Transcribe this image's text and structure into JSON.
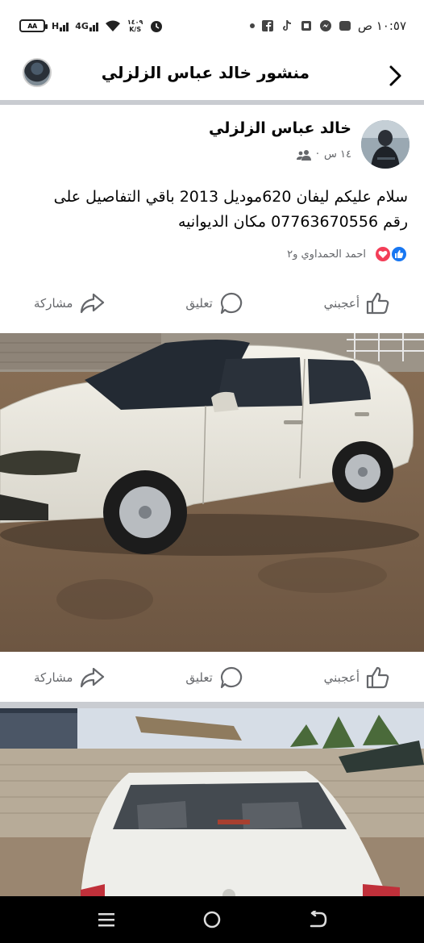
{
  "status_bar": {
    "time": "١٠:٥٧ ص",
    "battery": "AA",
    "network": "4G",
    "speed_value": "١٤٠٩",
    "speed_unit": "K/S",
    "notification_icons": [
      "dot-icon",
      "facebook-icon",
      "tiktok-icon",
      "sim-icon",
      "messenger-icon",
      "gallery-icon"
    ]
  },
  "header": {
    "title": "منشور خالد عباس الزلزلي",
    "back_icon": "chevron-right-icon"
  },
  "post": {
    "author": "خالد عباس الزلزلي",
    "time": "١٤ س",
    "separator": "·",
    "audience_icon": "friends-icon",
    "text_line1": "سلام عليكم ليفان 620موديل 2013 باقي التفاصيل على",
    "text_line2": "رقم 07763670556 مكان الديوانيه",
    "reactions_text": "احمد الحمداوي و٢",
    "reaction_icons": [
      "like-icon",
      "love-icon"
    ]
  },
  "actions": {
    "like": "أعجبني",
    "comment": "تعليق",
    "share": "مشاركة"
  },
  "colors": {
    "facebook_blue": "#1877f2",
    "love_red": "#f33e58",
    "secondary_text": "#65676b",
    "divider": "#c9ccd1"
  },
  "nav": {
    "icons": [
      "menu-icon",
      "home-icon",
      "back-icon"
    ]
  }
}
